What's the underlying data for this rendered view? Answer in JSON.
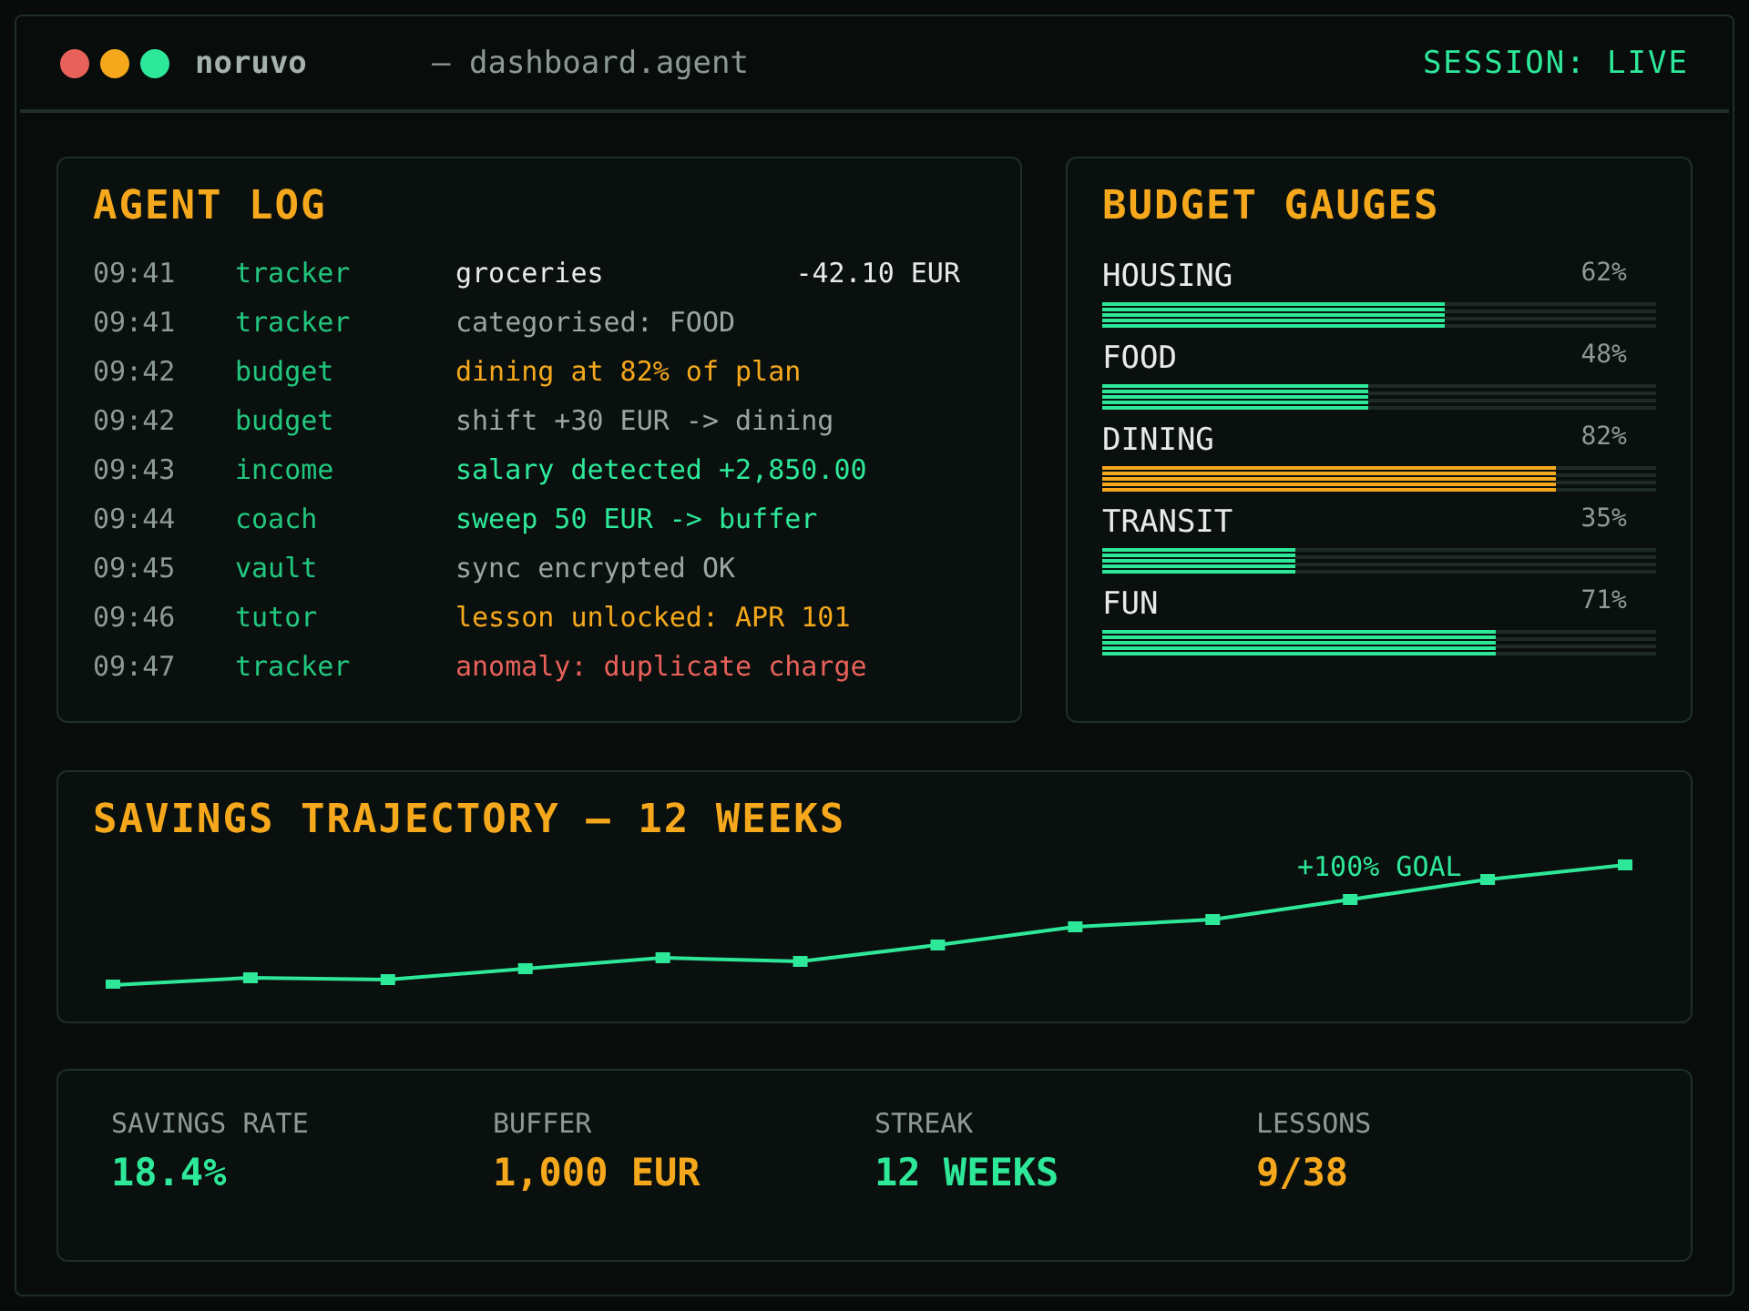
{
  "window": {
    "app_name": "noruvo",
    "title": "— dashboard.agent",
    "session": "SESSION: LIVE"
  },
  "agent_log": {
    "title": "AGENT LOG",
    "rows": [
      {
        "time": "09:41",
        "agent": "tracker",
        "message": "groceries",
        "amount": "-42.10 EUR",
        "color": "#e6ebe8"
      },
      {
        "time": "09:41",
        "agent": "tracker",
        "message": "categorised: FOOD",
        "color": "#9aa6a0"
      },
      {
        "time": "09:42",
        "agent": "budget",
        "message": "dining at 82% of plan",
        "color": "#f5a81c"
      },
      {
        "time": "09:42",
        "agent": "budget",
        "message": "shift +30 EUR -> dining",
        "color": "#9aa6a0"
      },
      {
        "time": "09:43",
        "agent": "income",
        "message": "salary detected +2,850.00",
        "color": "#2ee89a"
      },
      {
        "time": "09:44",
        "agent": "coach",
        "message": "sweep 50 EUR -> buffer",
        "color": "#2ee89a"
      },
      {
        "time": "09:45",
        "agent": "vault",
        "message": "sync encrypted OK",
        "color": "#9aa6a0"
      },
      {
        "time": "09:46",
        "agent": "tutor",
        "message": "lesson unlocked: APR 101",
        "color": "#f5a81c"
      },
      {
        "time": "09:47",
        "agent": "tracker",
        "message": "anomaly: duplicate charge",
        "color": "#e8615a"
      }
    ]
  },
  "budget_gauges": {
    "title": "BUDGET GAUGES",
    "items": [
      {
        "label": "HOUSING",
        "reading": "62%",
        "level": 0.62,
        "color": "#2ee89a"
      },
      {
        "label": "FOOD",
        "reading": "48%",
        "level": 0.48,
        "color": "#2ee89a"
      },
      {
        "label": "DINING",
        "reading": "82%",
        "level": 0.82,
        "color": "#f5a81c"
      },
      {
        "label": "TRANSIT",
        "reading": "35%",
        "level": 0.35,
        "color": "#2ee89a"
      },
      {
        "label": "FUN",
        "reading": "71%",
        "level": 0.71,
        "color": "#2ee89a"
      }
    ]
  },
  "savings_trajectory": {
    "title": "SAVINGS TRAJECTORY — 12 WEEKS",
    "annotation": "+100% GOAL"
  },
  "stats": [
    {
      "label": "SAVINGS RATE",
      "value": "18.4%",
      "color": "#2ee89a"
    },
    {
      "label": "BUFFER",
      "value": "1,000 EUR",
      "color": "#f5a81c"
    },
    {
      "label": "STREAK",
      "value": "12 WEEKS",
      "color": "#2ee89a"
    },
    {
      "label": "LESSONS",
      "value": "9/38",
      "color": "#f5a81c"
    }
  ]
}
